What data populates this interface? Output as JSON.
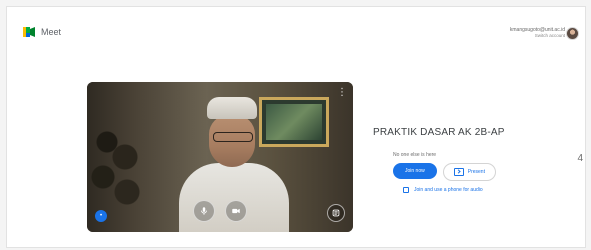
{
  "app": {
    "name": "Meet"
  },
  "account": {
    "email": "kmangsugoto@unit.ac.id",
    "switch_label": "Switch account"
  },
  "meeting": {
    "title": "PRAKTIK DASAR AK 2B-AP",
    "status": "No one else is here",
    "join_label": "Join now",
    "present_label": "Present",
    "phone_audio_label": "Join and use a phone for audio"
  },
  "preview": {
    "more_options": "⋮"
  },
  "edge": {
    "char": "4"
  },
  "colors": {
    "accent": "#1a73e8"
  },
  "icons": {
    "mic": "mic-icon",
    "camera": "camera-icon",
    "effects": "effects-icon",
    "avatar": "avatar"
  }
}
